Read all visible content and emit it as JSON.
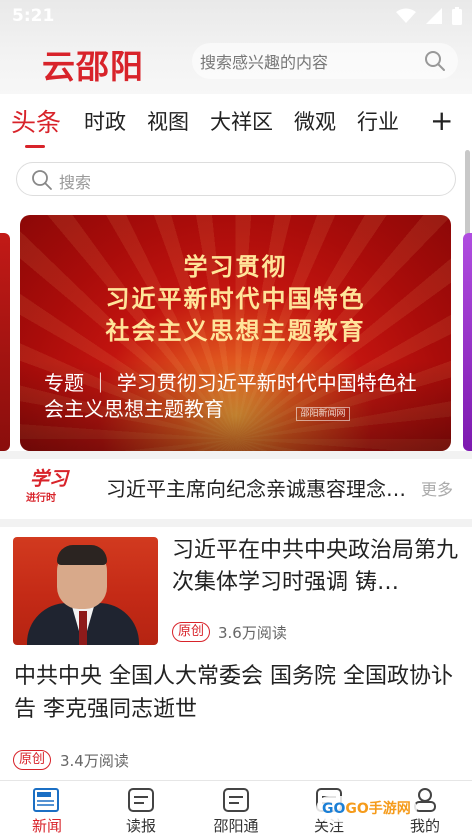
{
  "status_bar": {
    "time": "5:21"
  },
  "header": {
    "brand": "云邵阳",
    "search_placeholder": "搜索感兴趣的内容"
  },
  "tabs": [
    {
      "label": "头条",
      "active": true
    },
    {
      "label": "时政",
      "active": false
    },
    {
      "label": "视图",
      "active": false
    },
    {
      "label": "大祥区",
      "active": false
    },
    {
      "label": "微观",
      "active": false
    },
    {
      "label": "行业",
      "active": false
    }
  ],
  "tabs_add": "+",
  "inner_search": {
    "placeholder": "搜索"
  },
  "banner": {
    "line1": "学习贯彻",
    "line2": "习近平新时代中国特色",
    "line3": "社会主义思想主题教育",
    "caption": "专题 ｜ 学习贯彻习近平新时代中国特色社会主义思想主题教育",
    "watermark": "邵阳新闻网"
  },
  "ticker": {
    "logo_line1": "学习",
    "logo_line2": "进行时",
    "text": "习近平主席向纪念亲诚惠容理念提出十周年国际研讨会致贺信",
    "more": "更多"
  },
  "news": [
    {
      "title": "习近平在中共中央政治局第九次集体学习时强调 铸…",
      "badge": "原创",
      "reads": "3.6万阅读",
      "has_thumb": true
    },
    {
      "title": "中共中央 全国人大常委会 国务院 全国政协讣告 李克强同志逝世",
      "badge": "原创",
      "reads": "3.4万阅读",
      "has_thumb": false
    }
  ],
  "bottom_nav": [
    {
      "label": "新闻",
      "icon": "news-icon",
      "active": true
    },
    {
      "label": "读报",
      "icon": "newspaper-icon",
      "active": false
    },
    {
      "label": "邵阳通",
      "icon": "service-icon",
      "active": false
    },
    {
      "label": "关注",
      "icon": "follow-icon",
      "active": false
    },
    {
      "label": "我的",
      "icon": "user-icon",
      "active": false
    }
  ],
  "watermark_overlay": {
    "part1": "GO",
    "part2": "GO手游网"
  },
  "colors": {
    "accent": "#d8232a",
    "banner_text": "#ffe49a"
  }
}
